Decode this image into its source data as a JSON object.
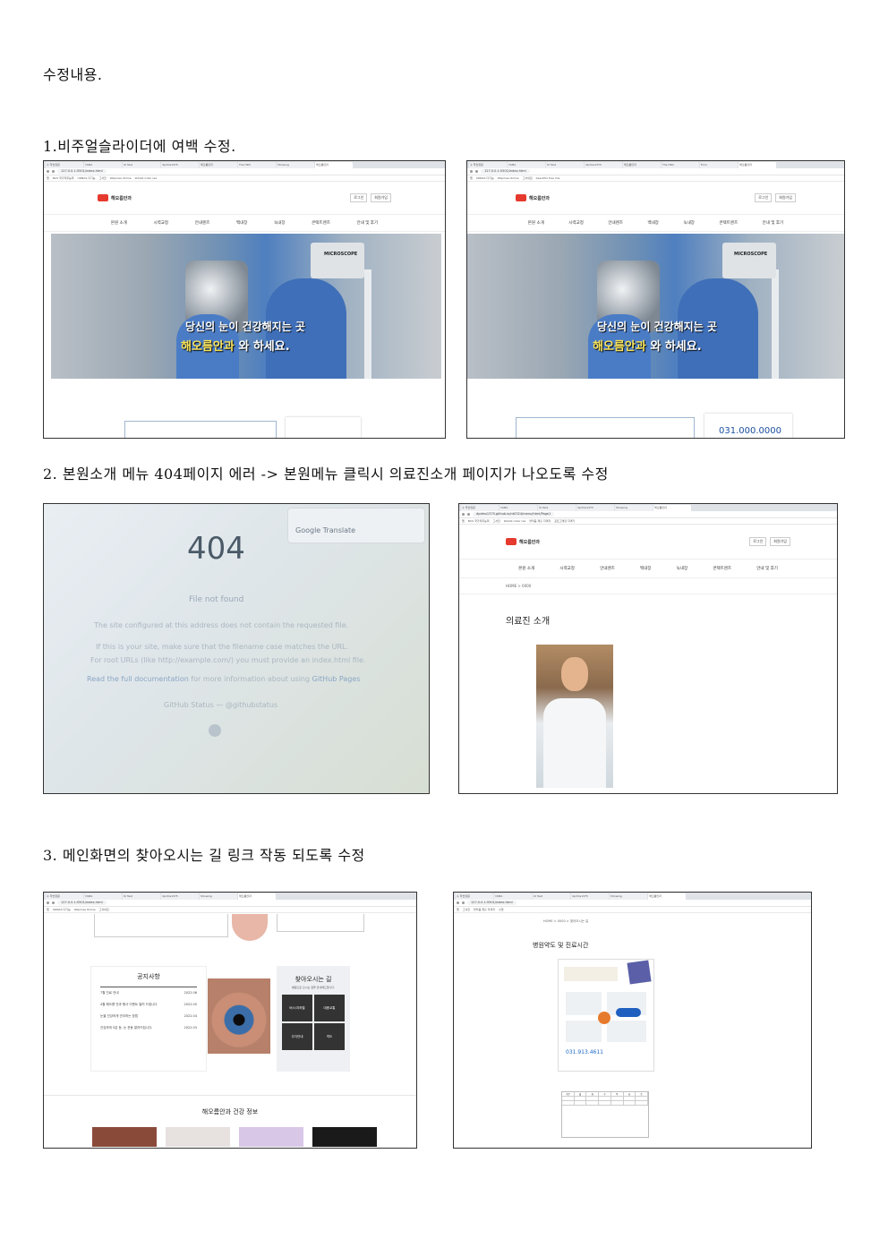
{
  "document": {
    "title": "수정내용.",
    "sections": [
      {
        "heading": "1.비주얼슬라이더에 여백 수정."
      },
      {
        "heading": "2. 본원소개 메뉴 404페이지 에러 -> 본원메뉴 클릭시 의료진소개 페이지가 나오도록 수정"
      },
      {
        "heading": "3. 메인화면의 찾아오시는 길 링크 작동 되도록 수정"
      }
    ]
  },
  "browser": {
    "url_local": "127.0.0.1:5501/index.html",
    "url_github": "dpdms1375.github.io/nt0324/menu/html/Page1",
    "tabs": [
      "수 학습정원",
      "YAMA",
      "UI Test",
      "dpdms1375",
      "해오름안과",
      "The HDC",
      "Showing",
      "Error",
      "해오름안과"
    ],
    "bookmarks": [
      "앱",
      "NCS 국가직무능력",
      "UDNAS 다기능",
      "그서진",
      "Wiiprisss Online",
      "kkkkst noter rea",
      "그서내집",
      "블러음 제출 자격자",
      "beautiful free ima",
      "포트그래킹 자격가",
      "수업",
      "튜토리얼 사이트",
      "Gallon - 영문 폰트"
    ]
  },
  "site": {
    "logo": "해오름안과",
    "login": "로그인",
    "join": "회원가입",
    "nav": [
      "본원 소개",
      "시력교정",
      "안내렌즈",
      "백내장",
      "녹내장",
      "콘택트렌즈",
      "안내 및 후기"
    ],
    "hero_line1": "당신의 눈이 건강해지는 곳",
    "hero_line2_a": "해오름안과",
    "hero_line2_b": "와",
    "hero_line2_c": "하세요.",
    "scope_brand": "MICROSCOPE",
    "phone": "031.000.0000"
  },
  "error404": {
    "translate": "Google Translate",
    "code": "404",
    "title": "File not found",
    "line1": "The site configured at this address does not contain the requested file.",
    "line2": "If this is your site, make sure that the filename case matches the URL.",
    "line3a": "For root URLs (like ",
    "line3_code": "http://example.com/",
    "line3b": ") you must provide an ",
    "line3_file": "index.html",
    "line3c": " file.",
    "line4a": "Read the full documentation",
    "line4b": " for more information about using ",
    "line4c": "GitHub Pages",
    "line5": "GitHub Status — @githubstatus"
  },
  "doctor_page": {
    "breadcrumb": "HOME  >  0000",
    "title": "의료진 소개"
  },
  "main_page": {
    "notice_title": "공지사항",
    "notices": [
      {
        "text": "7월 진료 안내",
        "date": "2022.06"
      },
      {
        "text": "4월 해오름 안과 행사 이벤트 알려 드립니다",
        "date": "2022.05"
      },
      {
        "text": "눈을 건강하게 관리하는 방법",
        "date": "2022.04"
      },
      {
        "text": "건강하게 5분 등, 눈 운동 알려드립니다.",
        "date": "2022.03"
      }
    ],
    "route_title": "찾아오시는 길",
    "route_sub": "병원으로 오시는 길을 안내해드립니다.",
    "route_items": [
      "버스/지하철",
      "대중교통",
      "주차안내",
      "약도"
    ],
    "health_title": "해오름안과 건강 정보"
  },
  "map_page": {
    "breadcrumb": "HOME  >  0000  >  찾아오시는 길",
    "title": "병원약도 및 진료시간",
    "phone": "031.913.4611",
    "days": [
      "구분",
      "월",
      "화",
      "수",
      "목",
      "금",
      "토"
    ],
    "colors": {
      "marker": "#e67a2c",
      "accent": "#1f5fbf"
    }
  }
}
